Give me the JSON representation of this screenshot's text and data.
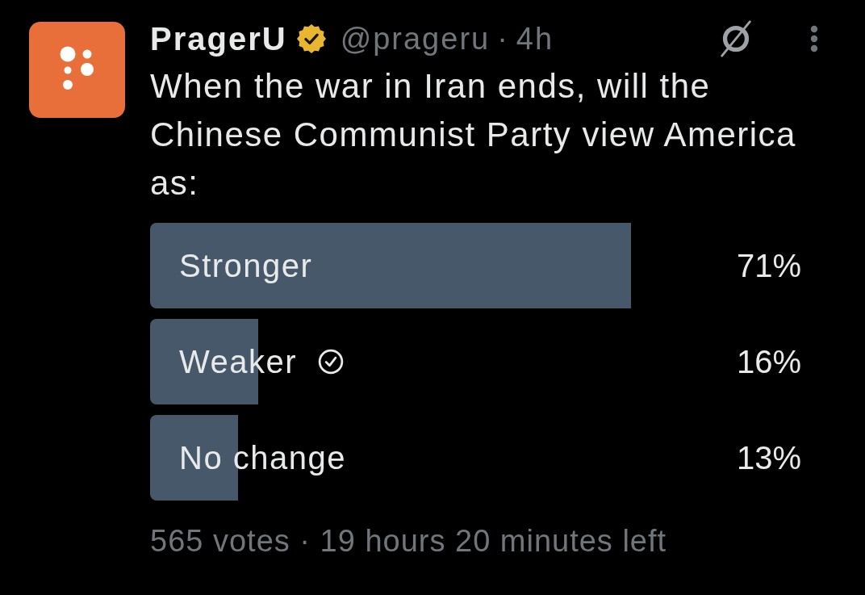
{
  "author": {
    "name": "PragerU",
    "verified": true,
    "handle": "@prageru",
    "separator": "·",
    "time": "4h"
  },
  "text": "When the war in Iran ends, will the Chinese Communist Party view America as:",
  "poll": {
    "options": [
      {
        "label": "Stronger",
        "percent": "71%",
        "level": 0.71,
        "selected": false
      },
      {
        "label": "Weaker",
        "percent": "16%",
        "level": 0.16,
        "selected": true
      },
      {
        "label": "No change",
        "percent": "13%",
        "level": 0.13,
        "selected": false
      }
    ],
    "summary": "565 votes · 19 hours 20 minutes left"
  }
}
